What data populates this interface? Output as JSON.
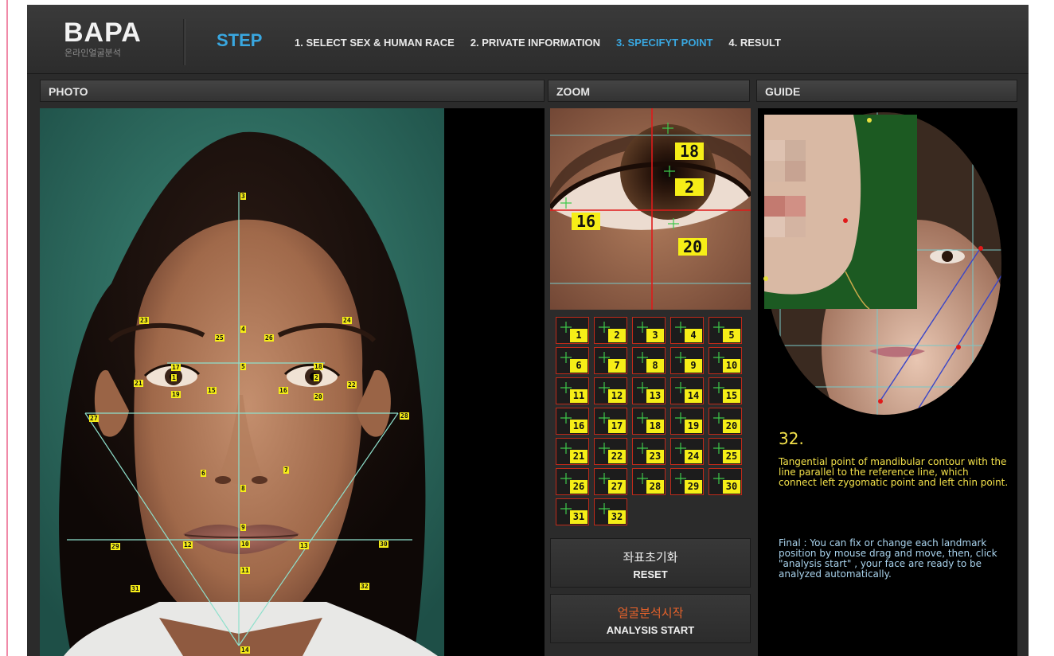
{
  "app": {
    "logo": "BAPA",
    "logo_sub": "온라인얼굴분석"
  },
  "header": {
    "step_title": "STEP",
    "steps": [
      {
        "label": "1. SELECT SEX & HUMAN RACE",
        "active": false
      },
      {
        "label": "2. PRIVATE INFORMATION",
        "active": false
      },
      {
        "label": "3. SPECIFYT POINT",
        "active": true
      },
      {
        "label": "4. RESULT",
        "active": false
      }
    ]
  },
  "panels": {
    "photo": "PHOTO",
    "zoom": "ZOOM",
    "guide": "GUIDE"
  },
  "landmarks": [
    "1",
    "2",
    "3",
    "4",
    "5",
    "6",
    "7",
    "8",
    "9",
    "10",
    "11",
    "12",
    "13",
    "14",
    "15",
    "16",
    "17",
    "18",
    "19",
    "20",
    "21",
    "22",
    "23",
    "24",
    "25",
    "26",
    "27",
    "28",
    "29",
    "30",
    "31",
    "32"
  ],
  "zoom_labels": [
    "18",
    "2",
    "16",
    "20"
  ],
  "point_buttons": [
    "1",
    "2",
    "3",
    "4",
    "5",
    "6",
    "7",
    "8",
    "9",
    "10",
    "11",
    "12",
    "13",
    "14",
    "15",
    "16",
    "17",
    "18",
    "19",
    "20",
    "21",
    "22",
    "23",
    "24",
    "25",
    "26",
    "27",
    "28",
    "29",
    "30",
    "31",
    "32"
  ],
  "buttons": {
    "reset_ko": "좌표초기화",
    "reset_en": "RESET",
    "analysis_ko": "얼굴분석시작",
    "analysis_en": "ANALYSIS START"
  },
  "guide": {
    "number": "32.",
    "description": "Tangential point of mandibular contour with the line parallel to the reference line, which connect left zygomatic point and left chin point.",
    "final": "Final : You can fix or change each landmark position by mouse drag and move, then, click \"analysis start\" , your face are ready to be analyzed automatically."
  },
  "colors": {
    "accent": "#39a7e0",
    "landmark": "#f6ee17",
    "analysis_text": "#e8622a",
    "guide_text": "#f2e04a",
    "guide_final_text": "#aad4ee",
    "grid_border": "#c02a1a"
  }
}
